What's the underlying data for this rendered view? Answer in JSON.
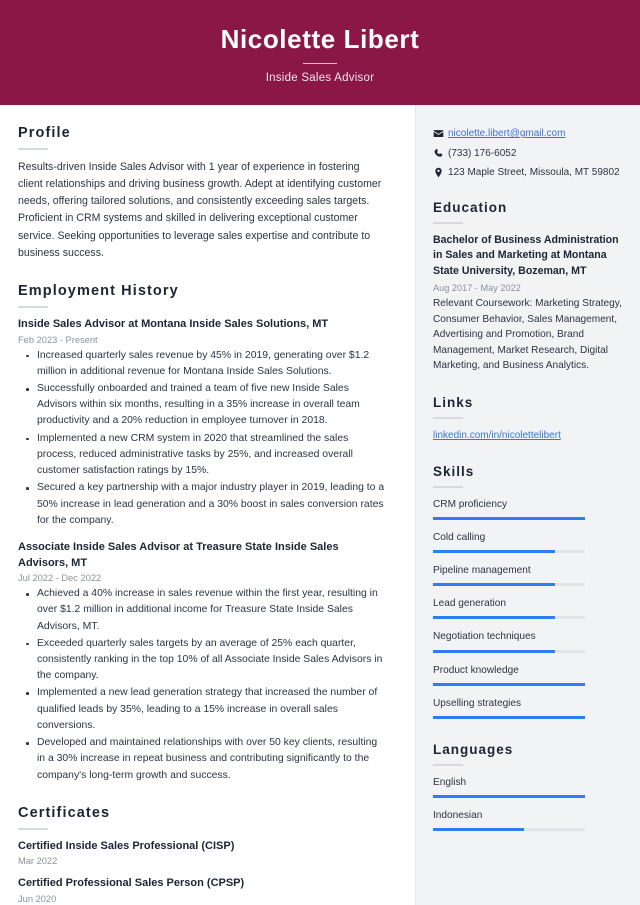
{
  "header": {
    "name": "Nicolette Libert",
    "job_title": "Inside Sales Advisor",
    "background_color": "#8b1746"
  },
  "accent_color": "#2f7df6",
  "link_color": "#3b72e8",
  "main": {
    "profile": {
      "heading": "Profile",
      "text": "Results-driven Inside Sales Advisor with 1 year of experience in fostering client relationships and driving business growth. Adept at identifying customer needs, offering tailored solutions, and consistently exceeding sales targets. Proficient in CRM systems and skilled in delivering exceptional customer service. Seeking opportunities to leverage sales expertise and contribute to business success."
    },
    "employment": {
      "heading": "Employment History",
      "jobs": [
        {
          "title": "Inside Sales Advisor at Montana Inside Sales Solutions, MT",
          "dates": "Feb 2023 - Present",
          "bullets": [
            "Increased quarterly sales revenue by 45% in 2019, generating over $1.2 million in additional revenue for Montana Inside Sales Solutions.",
            "Successfully onboarded and trained a team of five new Inside Sales Advisors within six months, resulting in a 35% increase in overall team productivity and a 20% reduction in employee turnover in 2018.",
            "Implemented a new CRM system in 2020 that streamlined the sales process, reduced administrative tasks by 25%, and increased overall customer satisfaction ratings by 15%.",
            "Secured a key partnership with a major industry player in 2019, leading to a 50% increase in lead generation and a 30% boost in sales conversion rates for the company."
          ]
        },
        {
          "title": "Associate Inside Sales Advisor at Treasure State Inside Sales Advisors, MT",
          "dates": "Jul 2022 - Dec 2022",
          "bullets": [
            "Achieved a 40% increase in sales revenue within the first year, resulting in over $1.2 million in additional income for Treasure State Inside Sales Advisors, MT.",
            "Exceeded quarterly sales targets by an average of 25% each quarter, consistently ranking in the top 10% of all Associate Inside Sales Advisors in the company.",
            "Implemented a new lead generation strategy that increased the number of qualified leads by 35%, leading to a 15% increase in overall sales conversions.",
            "Developed and maintained relationships with over 50 key clients, resulting in a 30% increase in repeat business and contributing significantly to the company's long-term growth and success."
          ]
        }
      ]
    },
    "certificates": {
      "heading": "Certificates",
      "items": [
        {
          "title": "Certified Inside Sales Professional (CISP)",
          "date": "Mar 2022"
        },
        {
          "title": "Certified Professional Sales Person (CPSP)",
          "date": "Jun 2020"
        }
      ]
    }
  },
  "sidebar": {
    "contact": [
      {
        "icon": "envelope-icon",
        "text": "nicolette.libert@gmail.com",
        "is_link": true
      },
      {
        "icon": "phone-icon",
        "text": "(733) 176-6052",
        "is_link": false
      },
      {
        "icon": "location-pin-icon",
        "text": "123 Maple Street, Missoula, MT 59802",
        "is_link": false
      }
    ],
    "education": {
      "heading": "Education",
      "degree": "Bachelor of Business Administration in Sales and Marketing at Montana State University, Bozeman, MT",
      "dates": "Aug 2017 - May 2022",
      "description": "Relevant Coursework: Marketing Strategy, Consumer Behavior, Sales Management, Advertising and Promotion, Brand Management, Market Research, Digital Marketing, and Business Analytics."
    },
    "links": {
      "heading": "Links",
      "items": [
        "linkedin.com/in/nicolettelibert"
      ]
    },
    "skills": {
      "heading": "Skills",
      "items": [
        {
          "label": "CRM proficiency",
          "level": 100
        },
        {
          "label": "Cold calling",
          "level": 80
        },
        {
          "label": "Pipeline management",
          "level": 80
        },
        {
          "label": "Lead generation",
          "level": 80
        },
        {
          "label": "Negotiation techniques",
          "level": 80
        },
        {
          "label": "Product knowledge",
          "level": 100
        },
        {
          "label": "Upselling strategies",
          "level": 100
        }
      ]
    },
    "languages": {
      "heading": "Languages",
      "items": [
        {
          "label": "English",
          "level": 100
        },
        {
          "label": "Indonesian",
          "level": 60
        }
      ]
    }
  }
}
